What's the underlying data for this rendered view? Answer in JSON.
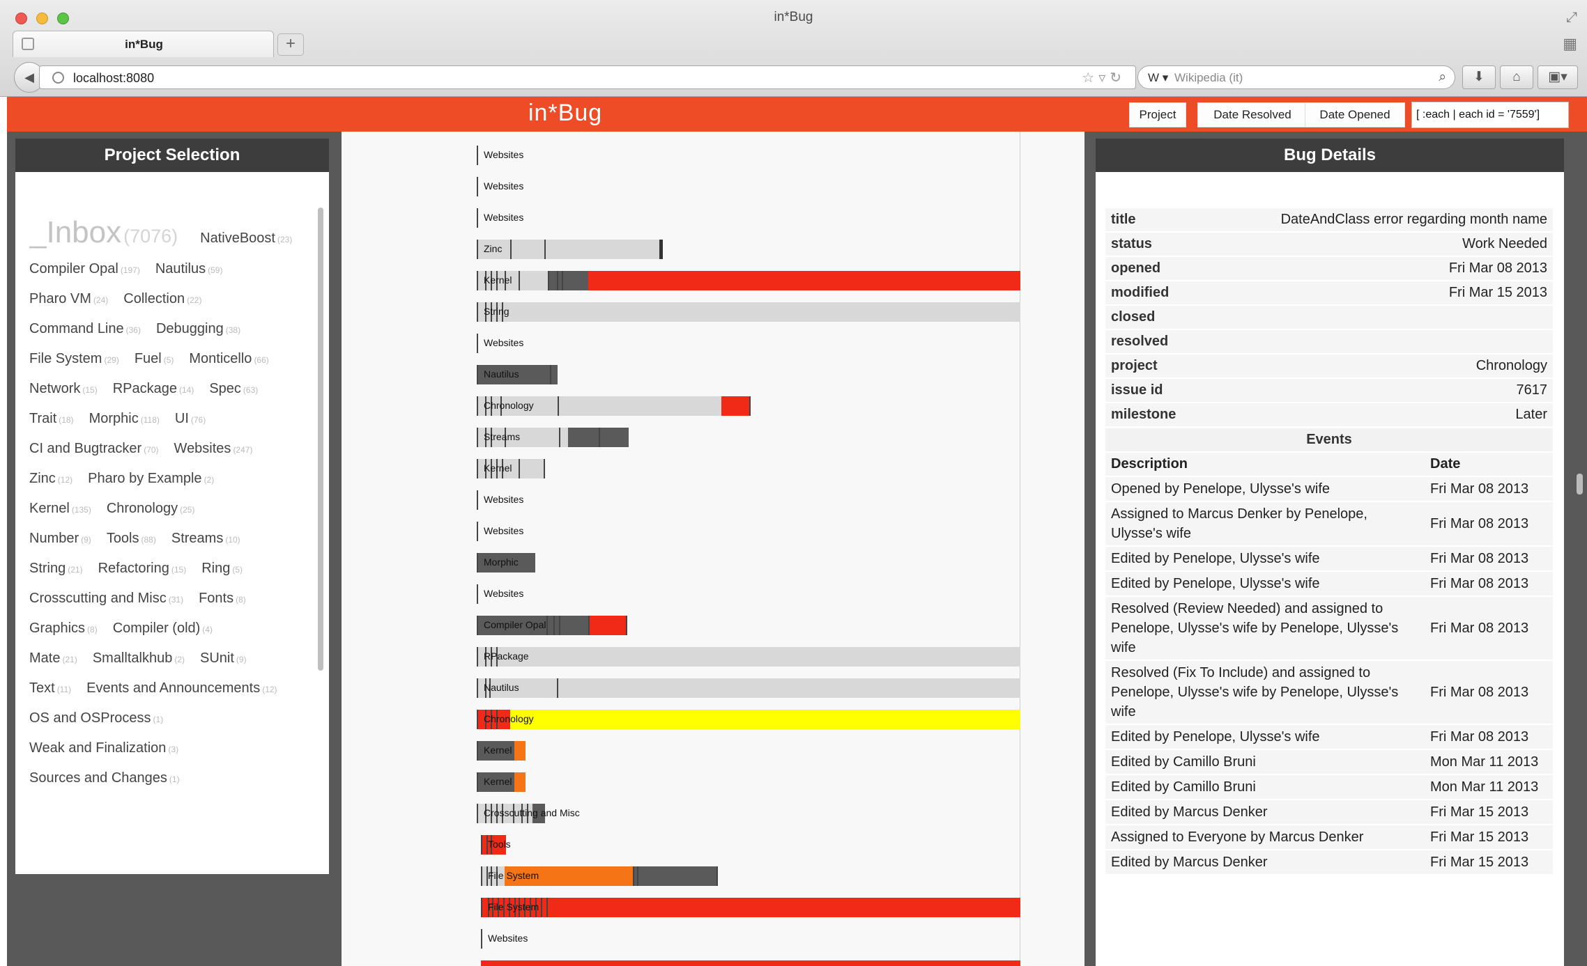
{
  "browser": {
    "window_title": "in*Bug",
    "tab_title": "in*Bug",
    "new_tab_label": "+",
    "url": "localhost:8080",
    "search_engine": "W ▾",
    "search_placeholder": "Wikipedia (it)"
  },
  "header": {
    "title": "in*Bug",
    "buttons": [
      "Project",
      "Date Resolved",
      "Date Opened"
    ],
    "query": "[ :each | each id = '7559']",
    "accent_color": "#ee4b27"
  },
  "project_selection": {
    "title": "Project Selection",
    "rows": [
      [
        {
          "name": "_Inbox",
          "count": "(7076)",
          "big": true
        },
        {
          "name": "NativeBoost",
          "count": "(23)"
        }
      ],
      [
        {
          "name": "Compiler Opal",
          "count": "(197)"
        },
        {
          "name": "Nautilus",
          "count": "(59)"
        }
      ],
      [
        {
          "name": "Pharo VM",
          "count": "(24)"
        },
        {
          "name": "Collection",
          "count": "(22)"
        }
      ],
      [
        {
          "name": "Command Line",
          "count": "(36)"
        },
        {
          "name": "Debugging",
          "count": "(38)"
        }
      ],
      [
        {
          "name": "File System",
          "count": "(29)"
        },
        {
          "name": "Fuel",
          "count": "(5)"
        },
        {
          "name": "Monticello",
          "count": "(66)"
        }
      ],
      [
        {
          "name": "Network",
          "count": "(15)"
        },
        {
          "name": "RPackage",
          "count": "(14)"
        },
        {
          "name": "Spec",
          "count": "(63)"
        }
      ],
      [
        {
          "name": "Trait",
          "count": "(18)"
        },
        {
          "name": "Morphic",
          "count": "(118)"
        },
        {
          "name": "UI",
          "count": "(76)"
        }
      ],
      [
        {
          "name": "CI and Bugtracker",
          "count": "(70)"
        },
        {
          "name": "Websites",
          "count": "(247)"
        }
      ],
      [
        {
          "name": "Zinc",
          "count": "(12)"
        },
        {
          "name": "Pharo by Example",
          "count": "(2)"
        }
      ],
      [
        {
          "name": "Kernel",
          "count": "(135)"
        },
        {
          "name": "Chronology",
          "count": "(25)"
        }
      ],
      [
        {
          "name": "Number",
          "count": "(9)"
        },
        {
          "name": "Tools",
          "count": "(88)"
        },
        {
          "name": "Streams",
          "count": "(10)"
        }
      ],
      [
        {
          "name": "String",
          "count": "(21)"
        },
        {
          "name": "Refactoring",
          "count": "(15)"
        },
        {
          "name": "Ring",
          "count": "(5)"
        }
      ],
      [
        {
          "name": "Crosscutting and Misc",
          "count": "(31)"
        },
        {
          "name": "Fonts",
          "count": "(8)"
        }
      ],
      [
        {
          "name": "Graphics",
          "count": "(8)"
        },
        {
          "name": "Compiler (old)",
          "count": "(4)"
        }
      ],
      [
        {
          "name": "Mate",
          "count": "(21)"
        },
        {
          "name": "Smalltalkhub",
          "count": "(2)"
        },
        {
          "name": "SUnit",
          "count": "(9)"
        }
      ],
      [
        {
          "name": "Text",
          "count": "(11)"
        },
        {
          "name": "Events and Announcements",
          "count": "(12)"
        }
      ],
      [
        {
          "name": "OS and OSProcess",
          "count": "(1)"
        }
      ],
      [
        {
          "name": "Weak and Finalization",
          "count": "(3)"
        }
      ],
      [
        {
          "name": "Sources and Changes",
          "count": "(1)"
        }
      ]
    ]
  },
  "timeline": {
    "colors": {
      "gray": "#d8d8d8",
      "dark": "#5a5a5a",
      "red": "#f02a17",
      "orange": "#f47416",
      "yellow": "#ffff00"
    },
    "rows": [
      {
        "label": "Websites",
        "bars": [],
        "ticks": [
          0
        ]
      },
      {
        "label": "Websites",
        "bars": [],
        "ticks": [
          0
        ]
      },
      {
        "label": "Websites",
        "bars": [],
        "ticks": [
          0
        ]
      },
      {
        "label": "Zinc",
        "bars": [
          [
            "gray",
            0,
            264
          ]
        ],
        "ticks": [
          0,
          48,
          97
        ],
        "end": 262
      },
      {
        "label": "Kernel",
        "bars": [
          [
            "gray",
            0,
            102
          ],
          [
            "dark",
            102,
            160
          ],
          [
            "red",
            160,
            780
          ]
        ],
        "ticks": [
          0,
          12,
          20,
          28,
          40,
          60,
          102,
          115,
          122
        ]
      },
      {
        "label": "String",
        "bars": [
          [
            "gray",
            0,
            780
          ]
        ],
        "ticks": [
          0,
          12,
          20,
          28,
          36
        ]
      },
      {
        "label": "Websites",
        "bars": [],
        "ticks": [
          0
        ]
      },
      {
        "label": "Nautilus",
        "bars": [
          [
            "dark",
            0,
            116
          ]
        ],
        "ticks": [
          0,
          105
        ]
      },
      {
        "label": "Chronology",
        "bars": [
          [
            "gray",
            0,
            351
          ],
          [
            "red",
            351,
            391
          ]
        ],
        "ticks": [
          0,
          12,
          20,
          34,
          116,
          391
        ]
      },
      {
        "label": "Streams",
        "bars": [
          [
            "gray",
            0,
            131
          ],
          [
            "dark",
            131,
            218
          ]
        ],
        "ticks": [
          0,
          12,
          20,
          40,
          118,
          175
        ]
      },
      {
        "label": "Kernel",
        "bars": [
          [
            "gray",
            0,
            98
          ]
        ],
        "ticks": [
          0,
          12,
          20,
          28,
          36,
          60,
          96
        ]
      },
      {
        "label": "Websites",
        "bars": [],
        "ticks": [
          0
        ]
      },
      {
        "label": "Websites",
        "bars": [],
        "ticks": [
          0
        ]
      },
      {
        "label": "Morphic",
        "bars": [
          [
            "dark",
            0,
            84
          ]
        ],
        "ticks": [
          0
        ]
      },
      {
        "label": "Websites",
        "bars": [],
        "ticks": [
          0
        ]
      },
      {
        "label": "Compiler Opal",
        "bars": [
          [
            "dark",
            0,
            160
          ],
          [
            "red",
            160,
            214
          ]
        ],
        "ticks": [
          0,
          100,
          110,
          118,
          160,
          214
        ]
      },
      {
        "label": "RPackage",
        "bars": [
          [
            "gray",
            0,
            780
          ]
        ],
        "ticks": [
          0,
          12,
          20,
          28
        ]
      },
      {
        "label": "Nautilus",
        "bars": [
          [
            "gray",
            0,
            780
          ]
        ],
        "ticks": [
          0,
          12,
          18,
          115
        ]
      },
      {
        "label": "Chronology",
        "bars": [
          [
            "red",
            0,
            48
          ],
          [
            "yellow",
            48,
            780
          ]
        ],
        "ticks": [
          0,
          12,
          20,
          28
        ]
      },
      {
        "label": "Kernel",
        "bars": [
          [
            "dark",
            0,
            54
          ],
          [
            "orange",
            54,
            70
          ]
        ],
        "ticks": [
          0
        ]
      },
      {
        "label": "Kernel",
        "bars": [
          [
            "dark",
            0,
            54
          ],
          [
            "orange",
            54,
            70
          ]
        ],
        "ticks": [
          0
        ]
      },
      {
        "label": "Crosscutting and Misc",
        "bars": [
          [
            "gray",
            0,
            80
          ],
          [
            "dark",
            80,
            98
          ]
        ],
        "ticks": [
          0,
          12,
          20,
          28,
          36,
          52,
          64,
          72
        ]
      },
      {
        "label": "Tools",
        "bars": [
          [
            "red",
            6,
            42
          ]
        ],
        "ticks": [
          6,
          14,
          20
        ]
      },
      {
        "label": "File System",
        "bars": [
          [
            "gray",
            6,
            40
          ],
          [
            "orange",
            40,
            224
          ],
          [
            "dark",
            224,
            344
          ]
        ],
        "ticks": [
          6,
          14,
          20,
          28,
          224,
          230,
          344
        ]
      },
      {
        "label": "File System",
        "bars": [
          [
            "red",
            6,
            780
          ]
        ],
        "ticks": [
          6,
          16,
          22,
          30,
          38,
          46,
          54,
          60,
          68,
          76,
          84,
          92,
          100
        ]
      },
      {
        "label": "Websites",
        "bars": [],
        "ticks": [
          6
        ]
      },
      {
        "label": "",
        "bars": [
          [
            "red",
            6,
            780
          ]
        ],
        "ticks": []
      }
    ]
  },
  "bug_details": {
    "title": "Bug Details",
    "fields": [
      {
        "key": "title",
        "value": "DateAndClass error regarding month name"
      },
      {
        "key": "status",
        "value": "Work Needed"
      },
      {
        "key": "opened",
        "value": "Fri Mar 08 2013"
      },
      {
        "key": "modified",
        "value": "Fri Mar 15 2013"
      },
      {
        "key": "closed",
        "value": ""
      },
      {
        "key": "resolved",
        "value": ""
      },
      {
        "key": "project",
        "value": "Chronology"
      },
      {
        "key": "issue id",
        "value": "7617"
      },
      {
        "key": "milestone",
        "value": "Later"
      }
    ],
    "events_title": "Events",
    "event_columns": [
      "Description",
      "Date"
    ],
    "events": [
      {
        "description": "Opened by Penelope, Ulysse's wife",
        "date": "Fri Mar 08 2013"
      },
      {
        "description": "Assigned to Marcus Denker by Penelope, Ulysse's wife",
        "date": "Fri Mar 08 2013"
      },
      {
        "description": "Edited by Penelope, Ulysse's wife",
        "date": "Fri Mar 08 2013"
      },
      {
        "description": "Edited by Penelope, Ulysse's wife",
        "date": "Fri Mar 08 2013"
      },
      {
        "description": "Resolved (Review Needed) and assigned to Penelope, Ulysse's wife by Penelope, Ulysse's wife",
        "date": "Fri Mar 08 2013"
      },
      {
        "description": "Resolved (Fix To Include) and assigned to Penelope, Ulysse's wife by Penelope, Ulysse's wife",
        "date": "Fri Mar 08 2013"
      },
      {
        "description": "Edited by Penelope, Ulysse's wife",
        "date": "Fri Mar 08 2013"
      },
      {
        "description": "Edited by Camillo Bruni",
        "date": "Mon Mar 11 2013"
      },
      {
        "description": "Edited by Camillo Bruni",
        "date": "Mon Mar 11 2013"
      },
      {
        "description": "Edited by Marcus Denker",
        "date": "Fri Mar 15 2013"
      },
      {
        "description": "Assigned to Everyone by Marcus Denker",
        "date": "Fri Mar 15 2013"
      },
      {
        "description": "Edited by Marcus Denker",
        "date": "Fri Mar 15 2013"
      }
    ]
  }
}
